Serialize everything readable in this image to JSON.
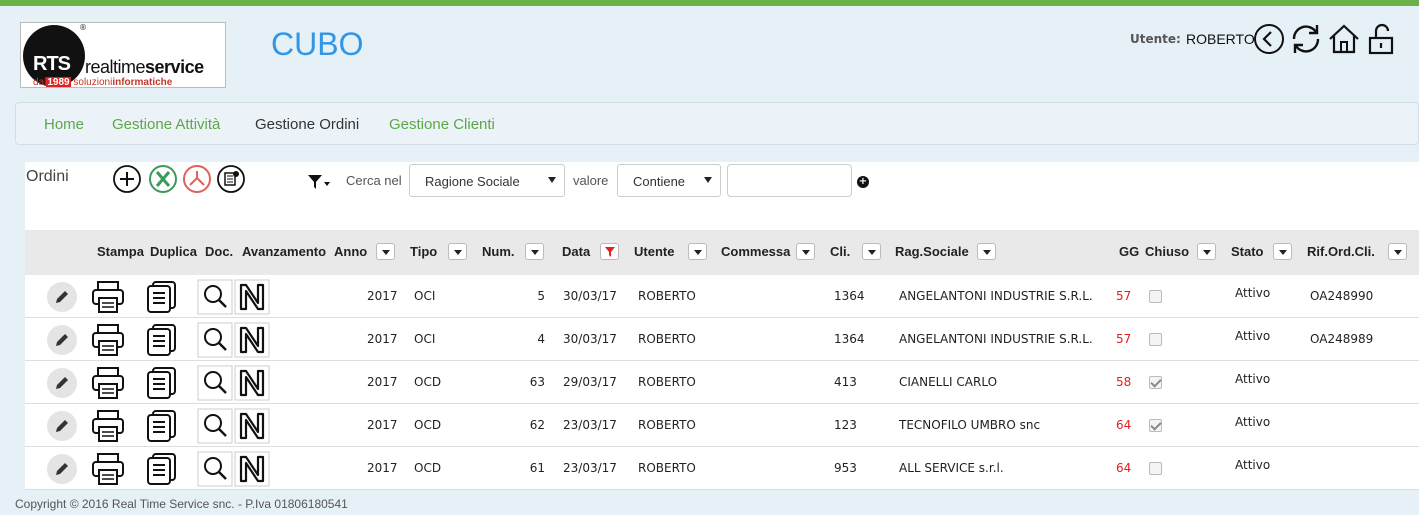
{
  "header": {
    "logo_text": {
      "rts": "RTS",
      "brand1": "realtime",
      "brand2": "service",
      "tagline_since": "dal",
      "tagline_year": "1989",
      "tagline_rest": " soluzioni",
      "tagline_bold": "informatiche",
      "reg": "®"
    },
    "app_title": "CUBO",
    "user_label": "Utente:",
    "user_name": "ROBERTO",
    "icons": [
      "back-icon",
      "refresh-icon",
      "home-icon",
      "unlock-icon"
    ]
  },
  "nav": {
    "items": [
      {
        "label": "Home",
        "active": false
      },
      {
        "label": "Gestione Attività",
        "active": false
      },
      {
        "label": "Gestione Ordini",
        "active": true
      },
      {
        "label": "Gestione Clienti",
        "active": false
      }
    ]
  },
  "toolbar": {
    "title": "Ordini",
    "buttons": [
      "add-icon",
      "excel-icon",
      "pdf-icon",
      "settings-icon"
    ],
    "cerca_label": "Cerca nel",
    "field_select": "Ragione Sociale",
    "valore_label": "valore",
    "operator_select": "Contiene",
    "search_value": "",
    "accent_color": "#5aa846"
  },
  "table": {
    "columns": [
      "Stampa",
      "Duplica",
      "Doc.",
      "Avanzamento",
      "Anno",
      "Tipo",
      "Num.",
      "Data",
      "Utente",
      "Commessa",
      "Cli.",
      "Rag.Sociale",
      "GG",
      "Chiuso",
      "Stato",
      "Rif.Ord.Cli."
    ],
    "rows": [
      {
        "anno": "2017",
        "tipo": "OCI",
        "num": "5",
        "data": "30/03/17",
        "utente": "ROBERTO",
        "commessa": "",
        "cli": "1364",
        "rag": "ANGELANTONI INDUSTRIE S.R.L.",
        "gg": "57",
        "chiuso": false,
        "stato": "Attivo",
        "rif": "OA248990"
      },
      {
        "anno": "2017",
        "tipo": "OCI",
        "num": "4",
        "data": "30/03/17",
        "utente": "ROBERTO",
        "commessa": "",
        "cli": "1364",
        "rag": "ANGELANTONI INDUSTRIE S.R.L.",
        "gg": "57",
        "chiuso": false,
        "stato": "Attivo",
        "rif": "OA248989"
      },
      {
        "anno": "2017",
        "tipo": "OCD",
        "num": "63",
        "data": "29/03/17",
        "utente": "ROBERTO",
        "commessa": "",
        "cli": "413",
        "rag": "CIANELLI CARLO",
        "gg": "58",
        "chiuso": true,
        "stato": "Attivo",
        "rif": ""
      },
      {
        "anno": "2017",
        "tipo": "OCD",
        "num": "62",
        "data": "23/03/17",
        "utente": "ROBERTO",
        "commessa": "",
        "cli": "123",
        "rag": "TECNOFILO UMBRO snc",
        "gg": "64",
        "chiuso": true,
        "stato": "Attivo",
        "rif": ""
      },
      {
        "anno": "2017",
        "tipo": "OCD",
        "num": "61",
        "data": "23/03/17",
        "utente": "ROBERTO",
        "commessa": "",
        "cli": "953",
        "rag": "ALL SERVICE s.r.l.",
        "gg": "64",
        "chiuso": false,
        "stato": "Attivo",
        "rif": ""
      }
    ]
  },
  "footer": {
    "copyright": "Copyright © 2016 Real Time Service snc. - P.Iva 01806180541"
  }
}
